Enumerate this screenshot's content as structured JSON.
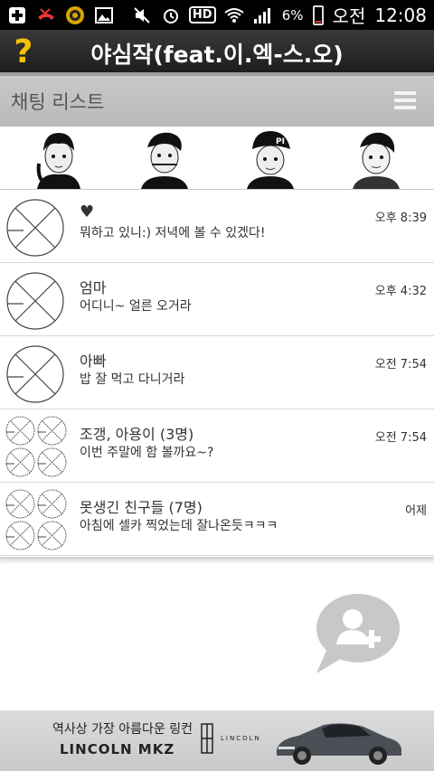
{
  "status_bar": {
    "battery": "6%",
    "ampm": "오전",
    "time": "12:08",
    "icons": [
      "add-icon",
      "missed-call-icon",
      "app-badge-icon",
      "image-icon",
      "mute-icon",
      "alarm-icon",
      "hd-icon",
      "wifi-icon",
      "signal-icon",
      "battery-icon"
    ],
    "hd_label": "HD"
  },
  "header": {
    "help_label": "?",
    "title": "야심작(feat.이.엑-스.오)"
  },
  "section": {
    "title": "채팅 리스트",
    "menu_icon": "hamburger-menu-icon"
  },
  "favorites": [
    {
      "name": "favorite-1"
    },
    {
      "name": "favorite-2"
    },
    {
      "name": "favorite-3",
      "cap_text": "PI"
    },
    {
      "name": "favorite-4"
    }
  ],
  "chats": [
    {
      "name": "♥",
      "message": "뭐하고 있니:) 저녁에 볼 수 있겠다!",
      "time": "오후 8:39",
      "group": false
    },
    {
      "name": "엄마",
      "message": "어디니~ 얼른 오거라",
      "time": "오후 4:32",
      "group": false
    },
    {
      "name": "아빠",
      "message": "밥 잘 먹고 다니거라",
      "time": "오전 7:54",
      "group": false
    },
    {
      "name": "조갱, 아용이 (3명)",
      "message": "이번 주말에 함 볼까요~?",
      "time": "오전 7:54",
      "group": true
    },
    {
      "name": "못생긴 친구들 (7명)",
      "message": "아침에 셀카 찍었는데 잘나온듯ㅋㅋㅋ",
      "time": "어제",
      "group": true
    }
  ],
  "fab": {
    "icon": "add-friend-chat-icon"
  },
  "ad": {
    "line1": "역사상 가장 아름다운 링컨",
    "line2": "LINCOLN MKZ",
    "brand": "LINCOLN"
  },
  "colors": {
    "title_bar": "#2a2a2a",
    "help_yellow": "#f2c300",
    "section_bg": "#c2c2c2",
    "fab_gray": "#c8c8c8"
  }
}
